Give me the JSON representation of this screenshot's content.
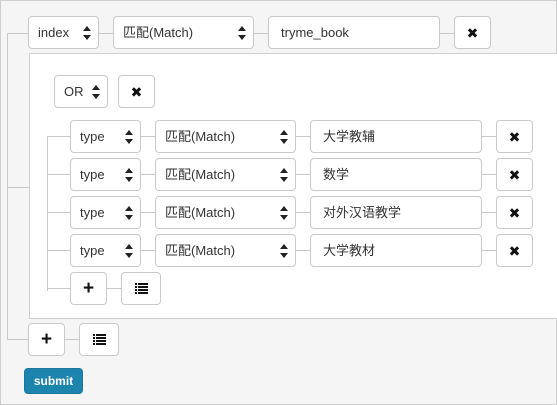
{
  "root": {
    "field": "index",
    "op": "匹配(Match)",
    "value": "tryme_book"
  },
  "group": {
    "logic": "OR",
    "rows": [
      {
        "field": "type",
        "op": "匹配(Match)",
        "value": "大学教辅"
      },
      {
        "field": "type",
        "op": "匹配(Match)",
        "value": "数学"
      },
      {
        "field": "type",
        "op": "匹配(Match)",
        "value": "对外汉语教学"
      },
      {
        "field": "type",
        "op": "匹配(Match)",
        "value": "大学教材"
      }
    ]
  },
  "icons": {
    "remove": "close-icon",
    "add": "plus-icon",
    "group": "list-icon"
  },
  "submit_label": "submit",
  "colors": {
    "submit_bg": "#1d84ae"
  }
}
